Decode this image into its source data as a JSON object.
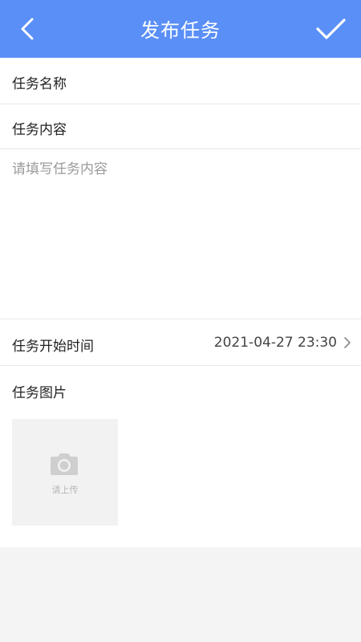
{
  "header": {
    "title": "发布任务"
  },
  "form": {
    "name_label": "任务名称",
    "content_label": "任务内容",
    "content_placeholder": "请填写任务内容",
    "start_time_label": "任务开始时间",
    "start_time_value": "2021-04-27 23:30",
    "image_label": "任务图片",
    "upload_text": "请上传"
  },
  "colors": {
    "header_bg": "#5a8ff7",
    "page_bg": "#f4f4f4"
  },
  "icons": {
    "back": "back-arrow-icon",
    "confirm": "checkmark-icon",
    "chevron": "chevron-right-icon",
    "camera": "camera-icon"
  }
}
